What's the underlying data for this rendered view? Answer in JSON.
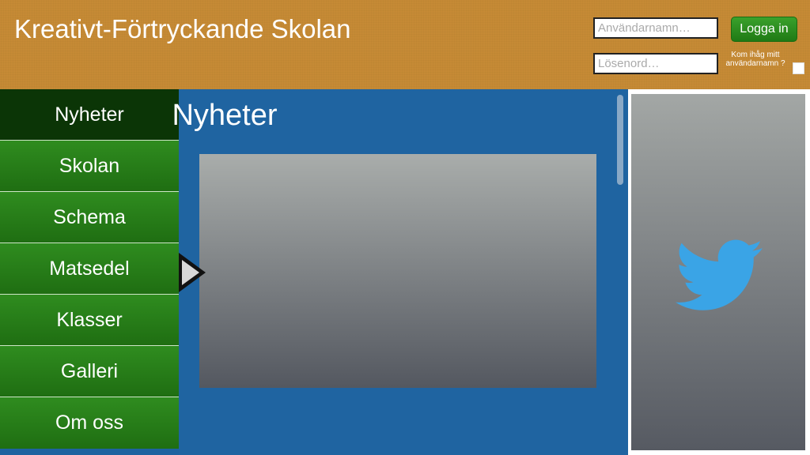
{
  "header": {
    "site_title": "Kreativt-Förtryckande Skolan",
    "username_placeholder": "Användarnamn…",
    "password_placeholder": "Lösenord…",
    "login_button": "Logga in",
    "remember_label": "Kom ihåg mitt användarnamn ?"
  },
  "sidebar": {
    "items": [
      {
        "label": "Nyheter"
      },
      {
        "label": "Skolan"
      },
      {
        "label": "Schema"
      },
      {
        "label": "Matsedel"
      },
      {
        "label": "Klasser"
      },
      {
        "label": "Galleri"
      },
      {
        "label": "Om oss"
      }
    ],
    "active_item": "Nyheter"
  },
  "main": {
    "title": "Nyheter"
  },
  "icons": {
    "selection_marker": "play-arrow-icon",
    "social": "twitter-bird-icon"
  },
  "colors": {
    "header_bg": "#c68a35",
    "nav_green": "#2f8c1f",
    "nav_active": "#0b3506",
    "main_blue": "#1f64a1",
    "twitter_blue": "#3aa4e6",
    "login_green": "#2c8f20"
  }
}
